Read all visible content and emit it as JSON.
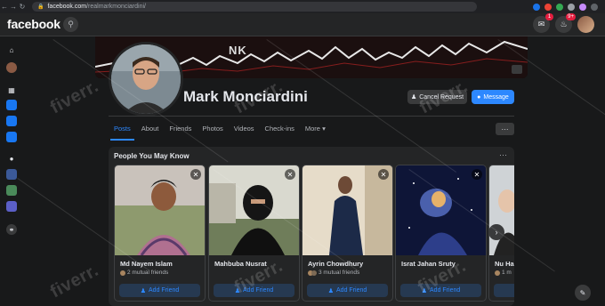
{
  "browser": {
    "url_host": "facebook.com",
    "url_path": "/realmarkmonciardini/"
  },
  "topbar": {
    "logo": "facebook",
    "messenger_badge": "1",
    "notifications_badge": "9+"
  },
  "profile": {
    "name": "Mark Monciardini",
    "cover_text": "NK",
    "cancel_request_label": "Cancel Request",
    "message_label": "Message"
  },
  "tabs": [
    {
      "label": "Posts"
    },
    {
      "label": "About"
    },
    {
      "label": "Friends"
    },
    {
      "label": "Photos"
    },
    {
      "label": "Videos"
    },
    {
      "label": "Check-ins"
    },
    {
      "label": "More"
    }
  ],
  "pymk": {
    "title": "People You May Know",
    "add_friend_label": "Add Friend",
    "people": [
      {
        "name": "Md Nayem Islam",
        "mutual": "2 mutual friends"
      },
      {
        "name": "Mahbuba Nusrat",
        "mutual": ""
      },
      {
        "name": "Ayrin Chowdhury",
        "mutual": "3 mutual friends"
      },
      {
        "name": "Israt Jahan Sruty",
        "mutual": ""
      },
      {
        "name": "Nu Ha",
        "mutual": "1 m"
      }
    ]
  },
  "watermark": "fiverr.",
  "colors": {
    "accent": "#2d88ff",
    "background": "#18191a",
    "surface": "#242526"
  }
}
